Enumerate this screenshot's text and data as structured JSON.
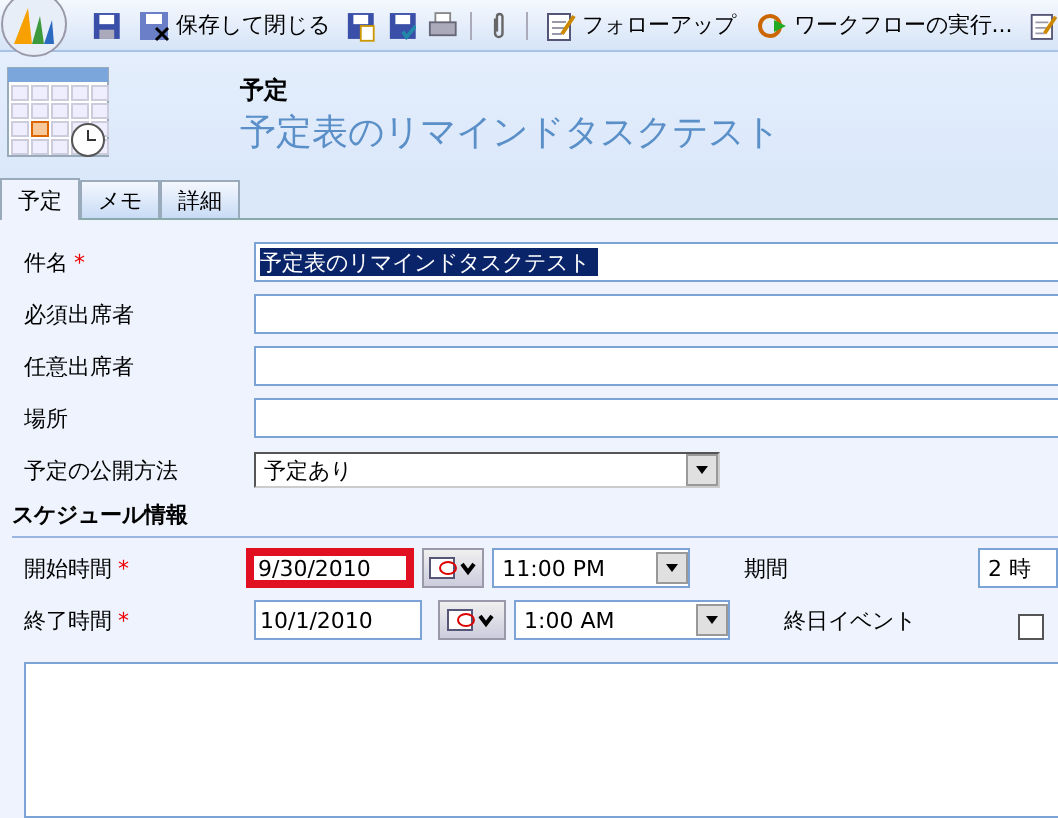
{
  "toolbar": [
    {
      "kind": "icon"
    },
    {
      "kind": "button",
      "label": "保存して閉じる"
    },
    {
      "kind": "icon"
    },
    {
      "kind": "icon"
    },
    {
      "kind": "icon"
    },
    {
      "kind": "separator"
    },
    {
      "kind": "icon"
    },
    {
      "kind": "separator"
    },
    {
      "kind": "button",
      "label": "フォローアップ"
    },
    {
      "kind": "button",
      "label": "ワークフローの実行..."
    },
    {
      "kind": "icon"
    }
  ],
  "header": {
    "entity": "予定",
    "title": "予定表のリマインドタスクテスト"
  },
  "tabs": [
    {
      "label": "予定",
      "selected": true
    },
    {
      "label": "メモ",
      "selected": false
    },
    {
      "label": "詳細",
      "selected": false
    }
  ],
  "fields": [
    {
      "label": "件名",
      "required_mark": "*",
      "kind": "text",
      "value": "予定表のリマインドタスクテスト",
      "selected_text": true
    },
    {
      "label": "必須出席者",
      "kind": "text",
      "selected_text": false
    },
    {
      "label": "任意出席者",
      "kind": "text",
      "selected_text": false
    },
    {
      "label": "場所",
      "kind": "text",
      "selected_text": false
    },
    {
      "label": "予定の公開方法",
      "kind": "select",
      "value": "予定あり"
    }
  ],
  "section": {
    "title": "スケジュール情報"
  },
  "schedule": [
    {
      "label": "開始時間",
      "required_mark": "*",
      "date": "9/30/2010",
      "highlighted": true,
      "time": "11:00 PM",
      "side": {
        "kind": "text",
        "label": "期間",
        "value": "2 時"
      }
    },
    {
      "label": "終了時間",
      "required_mark": "*",
      "date": "10/1/2010",
      "highlighted": false,
      "time": "1:00 AM",
      "side": {
        "kind": "checkbox",
        "label": "終日イベント",
        "checked": false
      }
    }
  ]
}
